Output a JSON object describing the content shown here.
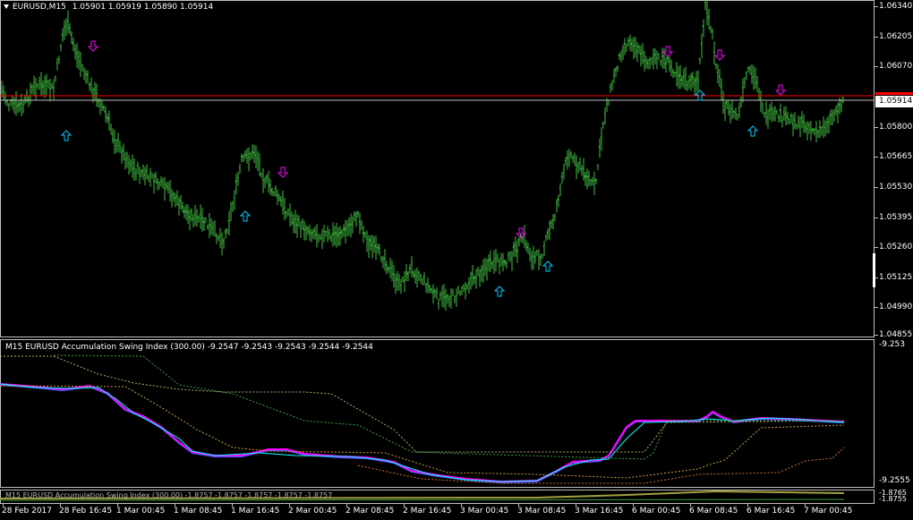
{
  "main": {
    "symbol_label": "EURUSD,M15",
    "ohlc": [
      "1.05901",
      "1.05919",
      "1.05890",
      "1.05914"
    ],
    "bid_price": "1.05914",
    "price_ticks": [
      "1.06340",
      "1.06205",
      "1.06070",
      "1.05935",
      "1.05800",
      "1.05665",
      "1.05530",
      "1.05395",
      "1.05260",
      "1.05125",
      "1.04990",
      "1.04855"
    ],
    "colors": {
      "bars": "#3fbf3f",
      "up_arrow": "#00c8ff",
      "down_arrow": "#ff00ff",
      "bid_line": "#c0c0c0",
      "ask_line": "#ff0000"
    }
  },
  "indicator": {
    "title": "M15 EURUSD Accumulation Swing Index (300.00) -9.2547 -9.2543 -9.2543 -9.2544 -9.2544",
    "top_value": "-9.253",
    "bottom_value": "-9.2555",
    "colors": {
      "line1": "#ff00ff",
      "line2": "#4060ff",
      "line3": "#00ffff"
    }
  },
  "sub_indicator": {
    "title": "M15 EURUSD Accumulation Swing Index (300.00) -1.8757 -1.8757 -1.8757 -1.8757 -1.8757",
    "top_value": "-1.8765",
    "bottom_value": "-1.8755"
  },
  "time_axis": [
    "28 Feb 2017",
    "28 Feb 16:45",
    "1 Mar 00:45",
    "1 Mar 08:45",
    "1 Mar 16:45",
    "2 Mar 00:45",
    "2 Mar 08:45",
    "2 Mar 16:45",
    "3 Mar 00:45",
    "3 Mar 08:45",
    "3 Mar 16:45",
    "6 Mar 00:45",
    "6 Mar 08:45",
    "6 Mar 16:45",
    "7 Mar 00:45"
  ]
}
